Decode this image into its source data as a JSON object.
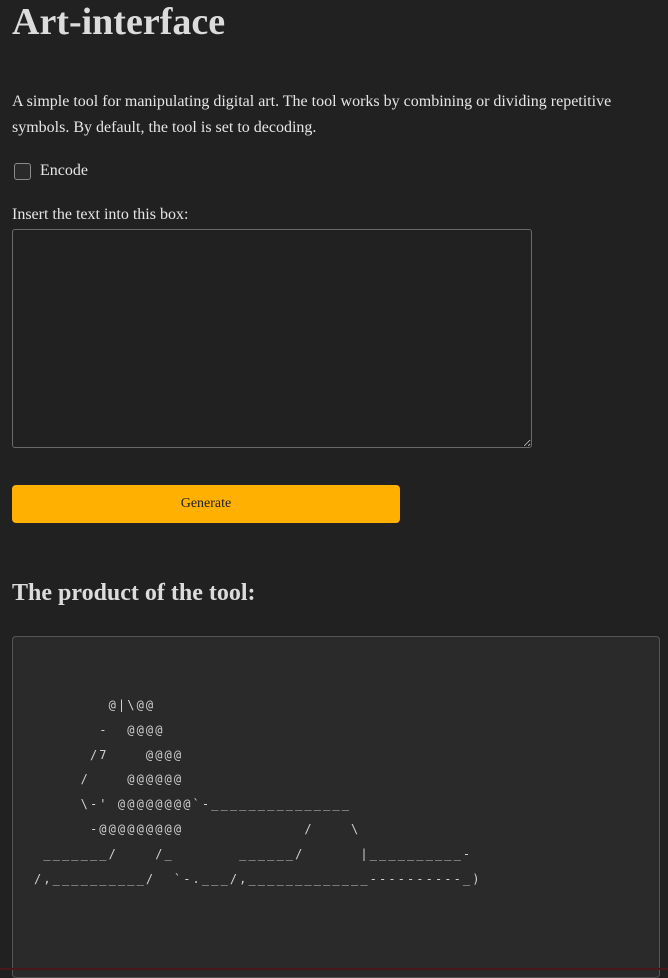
{
  "title": "Art-interface",
  "description": "A simple tool for manipulating digital art. The tool works by combining or dividing repetitive symbols. By default, the tool is set to decoding.",
  "encode": {
    "label": "Encode",
    "checked": false
  },
  "input": {
    "label": "Insert the text into this box:",
    "value": ""
  },
  "generate_label": "Generate",
  "output": {
    "heading": "The product of the tool:",
    "art": "        @|\\@@\n       -  @@@@\n      /7    @@@@\n     /    @@@@@@\n     \\-' @@@@@@@@`-_______________\n      -@@@@@@@@@             /    \\\n _______/    /_       ______/      |__________-\n/,__________/  `-.___/,_____________----------_)"
  },
  "colors": {
    "accent": "#ffb000",
    "background": "#212121"
  }
}
